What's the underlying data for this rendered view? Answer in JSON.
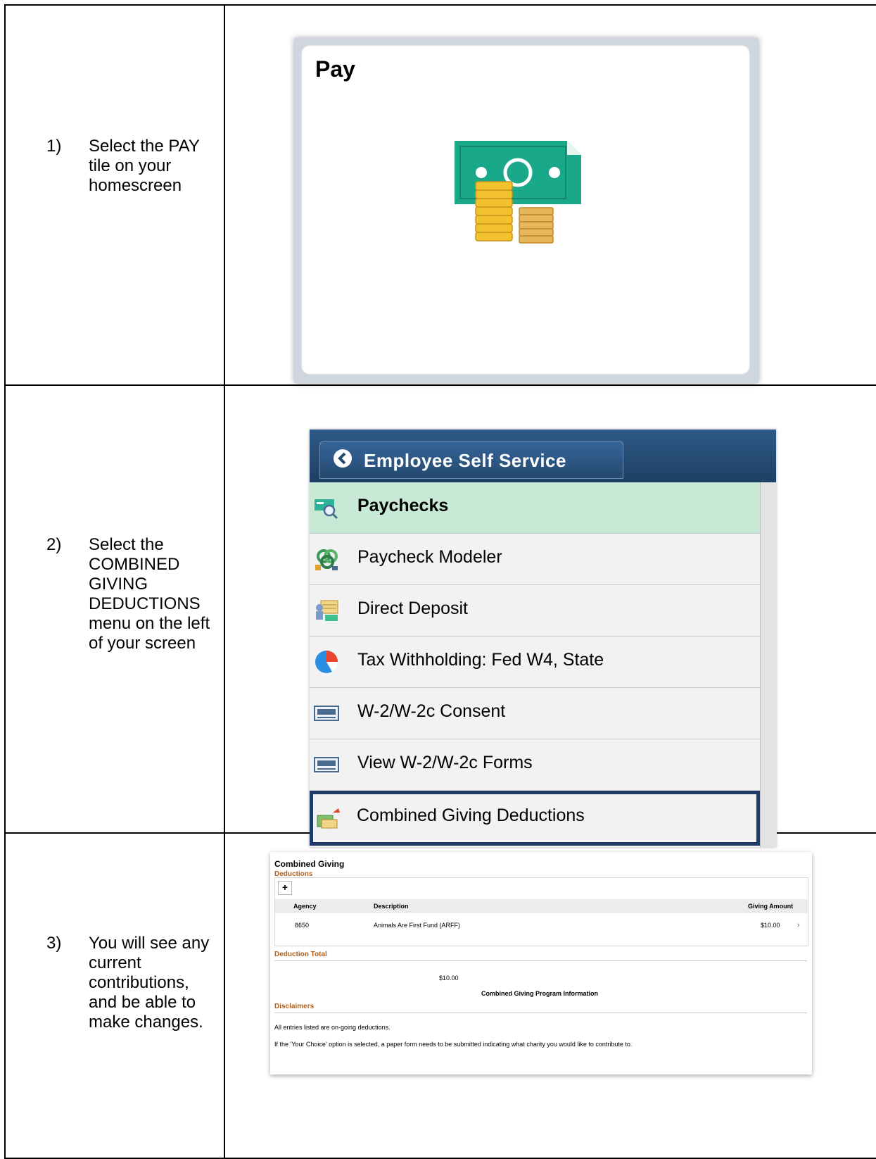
{
  "steps": [
    {
      "num": "1)",
      "text": "Select the PAY tile on your homescreen"
    },
    {
      "num": "2)",
      "text": "Select the COMBINED GIVING DEDUCTIONS menu on the left of your screen"
    },
    {
      "num": "3)",
      "text": "You will see any current contributions, and be able to make changes."
    }
  ],
  "pay_tile": {
    "title": "Pay",
    "icon": "money-coins-icon"
  },
  "ess": {
    "back_label": "Employee Self Service",
    "items": [
      {
        "label": "Paychecks",
        "icon": "paycheck-search-icon",
        "state": "active"
      },
      {
        "label": "Paycheck Modeler",
        "icon": "modeler-icon",
        "state": "normal"
      },
      {
        "label": "Direct Deposit",
        "icon": "direct-deposit-icon",
        "state": "normal"
      },
      {
        "label": "Tax Withholding: Fed W4, State",
        "icon": "pie-chart-icon",
        "state": "normal"
      },
      {
        "label": "W-2/W-2c Consent",
        "icon": "w2-form-icon",
        "state": "normal"
      },
      {
        "label": "View W-2/W-2c Forms",
        "icon": "w2-form-icon",
        "state": "normal"
      },
      {
        "label": "Combined Giving Deductions",
        "icon": "giving-icon",
        "state": "selected"
      }
    ],
    "colors": {
      "header": "#1f3f63",
      "active": "#c8e9d6",
      "selected_border": "#1e3a66"
    }
  },
  "combined_giving": {
    "title": "Combined Giving",
    "deductions_label": "Deductions",
    "add_symbol": "+",
    "columns": {
      "agency": "Agency",
      "description": "Description",
      "amount": "Giving Amount"
    },
    "rows": [
      {
        "agency": "8650",
        "description": "Animals Are First Fund (ARFF)",
        "amount": "$10.00"
      }
    ],
    "total_label": "Deduction Total",
    "total_value": "$10.00",
    "program_info": "Combined Giving Program Information",
    "disclaimers_label": "Disclaimers",
    "disclaimer_1": "All entries listed are on-going deductions.",
    "disclaimer_2": "If the 'Your Choice' option is selected, a paper form needs to be submitted indicating what charity you would like to contribute to."
  }
}
